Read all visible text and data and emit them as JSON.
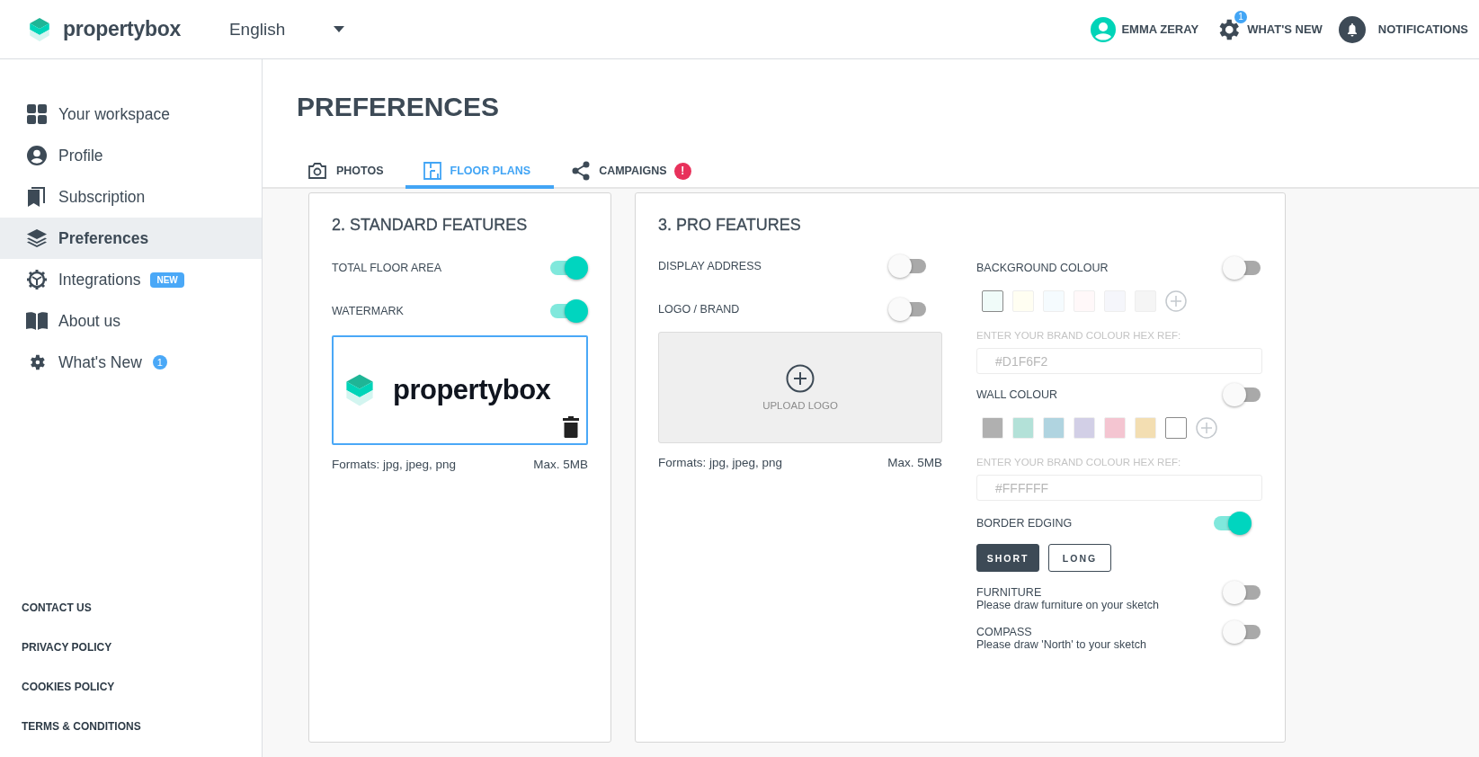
{
  "header": {
    "logo_text": "propertybox",
    "language": "English",
    "user_name": "EMMA ZERAY",
    "whats_new": "WHAT'S NEW",
    "whats_new_badge": "1",
    "notifications": "NOTIFICATIONS"
  },
  "sidebar": {
    "items": [
      {
        "label": "Your workspace",
        "selected": false
      },
      {
        "label": "Profile",
        "selected": false
      },
      {
        "label": "Subscription",
        "selected": false
      },
      {
        "label": "Preferences",
        "selected": true
      },
      {
        "label": "Integrations",
        "selected": false,
        "badge": "NEW"
      },
      {
        "label": "About us",
        "selected": false
      },
      {
        "label": "What's New",
        "selected": false,
        "count": "1"
      }
    ],
    "footer_links": [
      "CONTACT US",
      "PRIVACY POLICY",
      "COOKIES POLICY",
      "TERMS & CONDITIONS"
    ]
  },
  "page_title": "PREFERENCES",
  "tabs": [
    {
      "label": "PHOTOS",
      "selected": false
    },
    {
      "label": "FLOOR PLANS",
      "selected": true
    },
    {
      "label": "CAMPAIGNS",
      "selected": false,
      "alert": "!"
    }
  ],
  "standard_features": {
    "title": "2. STANDARD FEATURES",
    "toggles": [
      {
        "label": "TOTAL FLOOR AREA",
        "on": true
      },
      {
        "label": "WATERMARK",
        "on": true
      }
    ],
    "watermark_logo_text": "propertybox",
    "formats": "Formats: jpg, jpeg, png",
    "max_size": "Max. 5MB"
  },
  "pro_features": {
    "title": "3. PRO FEATURES",
    "toggles": [
      {
        "label": "DISPLAY ADDRESS",
        "on": false
      },
      {
        "label": "LOGO / BRAND",
        "on": false
      }
    ],
    "upload_label": "UPLOAD LOGO",
    "formats": "Formats: jpg, jpeg, png",
    "max_size": "Max. 5MB",
    "background_colour": {
      "label": "BACKGROUND COLOUR",
      "on": false,
      "swatches": [
        {
          "color": "#f0fbf9",
          "selected": true
        },
        {
          "color": "#fffef2",
          "selected": false
        },
        {
          "color": "#f5fbfe",
          "selected": false
        },
        {
          "color": "#fff8f9",
          "selected": false
        },
        {
          "color": "#f5f6fb",
          "selected": false
        },
        {
          "color": "#f5f5f5",
          "selected": false
        }
      ],
      "hex_label": "ENTER YOUR BRAND COLOUR HEX REF:",
      "hex_value": "#D1F6F2",
      "disabled": true
    },
    "wall_colour": {
      "label": "WALL COLOUR",
      "on": false,
      "swatches": [
        {
          "color": "#b0b0b0",
          "selected": false
        },
        {
          "color": "#b3e1d8",
          "selected": false
        },
        {
          "color": "#b0d4e0",
          "selected": false
        },
        {
          "color": "#d2cfe6",
          "selected": false
        },
        {
          "color": "#f4c5d1",
          "selected": false
        },
        {
          "color": "#f3deb2",
          "selected": false
        },
        {
          "color": "#ffffff",
          "selected": true
        }
      ],
      "hex_label": "ENTER YOUR BRAND COLOUR HEX REF:",
      "hex_value": "#FFFFFF",
      "disabled": true
    },
    "border_edging": {
      "label": "BORDER EDGING",
      "on": true,
      "options": [
        {
          "label": "SHORT",
          "selected": true
        },
        {
          "label": "LONG",
          "selected": false
        }
      ]
    },
    "furniture": {
      "label": "FURNITURE",
      "description": "Please draw furniture on your sketch",
      "on": false
    },
    "compass": {
      "label": "COMPASS",
      "description": "Please draw 'North' to your sketch",
      "on": false
    }
  }
}
